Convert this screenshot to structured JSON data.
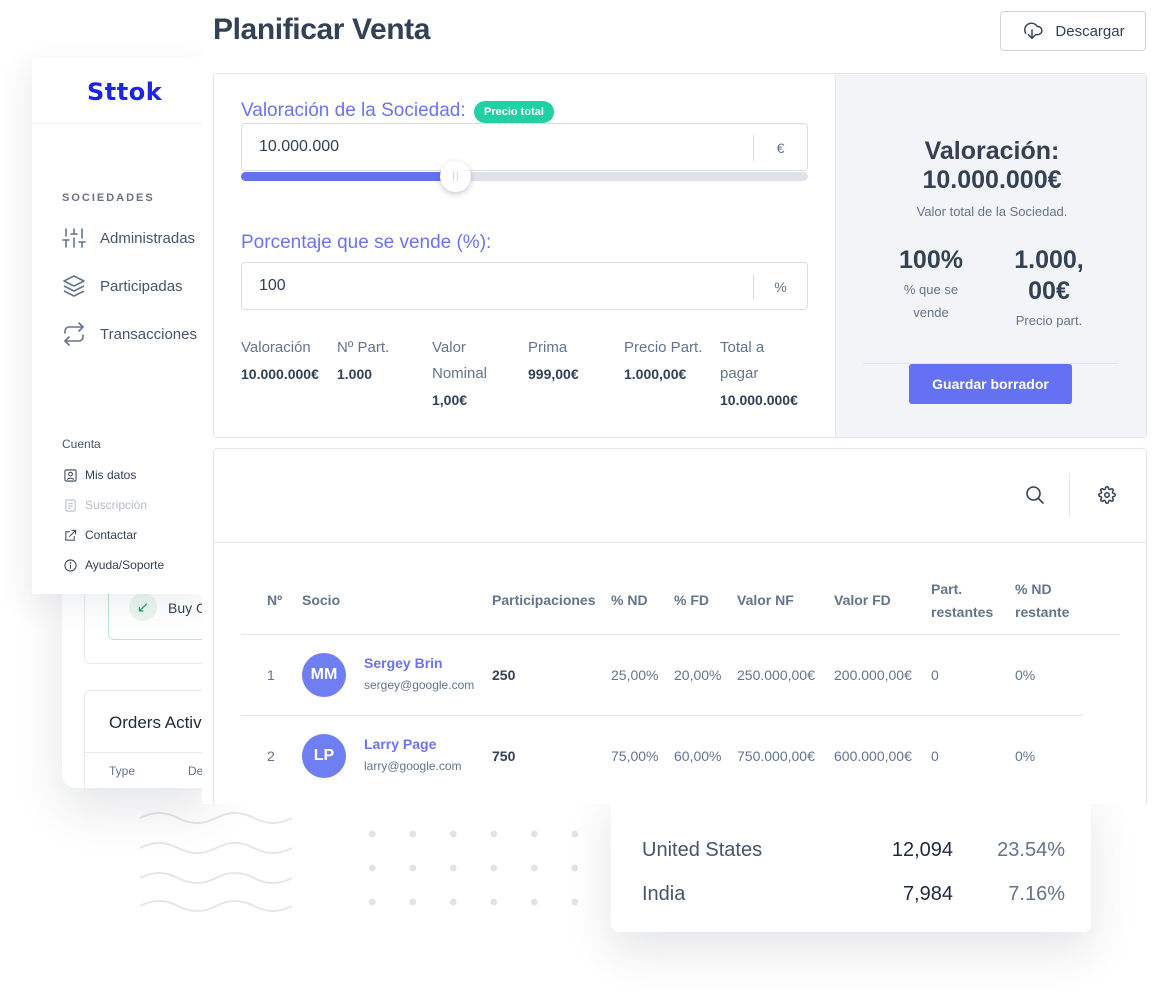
{
  "sidebar": {
    "logo": "Sttok",
    "section_label": "SOCIEDADES",
    "items": [
      {
        "label": "Administradas",
        "icon": "sliders-icon"
      },
      {
        "label": "Participadas",
        "icon": "layers-icon"
      },
      {
        "label": "Transacciones",
        "icon": "swap-arrows-icon"
      }
    ],
    "account_label": "Cuenta",
    "account_items": [
      {
        "label": "Mis datos",
        "icon": "user-icon"
      },
      {
        "label": "Suscripción",
        "icon": "document-icon",
        "disabled": true
      },
      {
        "label": "Contactar",
        "icon": "external-link-icon"
      },
      {
        "label": "Ayuda/Soporte",
        "icon": "info-icon"
      }
    ]
  },
  "header": {
    "title": "Planificar Venta",
    "download_label": "Descargar"
  },
  "valuation": {
    "label": "Valoración de la Sociedad:",
    "badge": "Precio total",
    "value": "10.000.000",
    "suffix": "€",
    "slider_fraction": 0.38
  },
  "percentage": {
    "label": "Porcentaje que se vende (%):",
    "value": "100",
    "suffix": "%"
  },
  "summary": {
    "valoracion_label": "Valoración",
    "valoracion_value": "10.000.000€",
    "npart_label": "Nº Part.",
    "npart_value": "1.000",
    "nominal_label_1": "Valor",
    "nominal_label_2": "Nominal",
    "nominal_value": "1,00€",
    "prima_label": "Prima",
    "prima_value": "999,00€",
    "precio_label": "Precio Part.",
    "precio_value": "1.000,00€",
    "total_label_1": "Total a",
    "total_label_2": "pagar",
    "total_value": "10.000.000€"
  },
  "summary_card": {
    "title_1": "Valoración:",
    "title_2": "10.000.000€",
    "subtitle": "Valor total de la Sociedad.",
    "pct_value": "100%",
    "pct_label_1": "% que se",
    "pct_label_2": "vende",
    "price_value_1": "1.000,",
    "price_value_2": "00€",
    "price_label": "Precio part.",
    "save_label": "Guardar borrador"
  },
  "table": {
    "headers": {
      "num": "Nº",
      "socio": "Socio",
      "participaciones": "Participaciones",
      "nd": "% ND",
      "fd": "% FD",
      "valor_nf": "Valor NF",
      "valor_fd": "Valor FD",
      "part_rest_1": "Part.",
      "part_rest_2": "restantes",
      "nd_rest_1": "% ND",
      "nd_rest_2": "restante"
    },
    "rows": [
      {
        "num": "1",
        "initials": "MM",
        "name": "Sergey Brin",
        "email": "sergey@google.com",
        "participaciones": "250",
        "nd": "25,00%",
        "fd": "20,00%",
        "valor_nf": "250.000,00€",
        "valor_fd": "200.000,00€",
        "part_rest": "0",
        "nd_rest": "0%"
      },
      {
        "num": "2",
        "initials": "LP",
        "name": "Larry Page",
        "email": "larry@google.com",
        "participaciones": "750",
        "nd": "75,00%",
        "fd": "60,00%",
        "valor_nf": "750.000,00€",
        "valor_fd": "600.000,00€",
        "part_rest": "0",
        "nd_rest": "0%"
      }
    ]
  },
  "background": {
    "buy_text": "Buy O",
    "orders_title": "Orders Activi",
    "orders_type": "Type",
    "orders_de": "De",
    "countries": [
      {
        "name": "United States",
        "value": "12,094",
        "pct": "23.54%"
      },
      {
        "name": "India",
        "value": "7,984",
        "pct": "7.16%"
      }
    ]
  },
  "colors": {
    "accent": "#6371f2",
    "badge": "#21d1a4",
    "logo": "#1d24e6",
    "avatar": "#6f7ff3"
  }
}
